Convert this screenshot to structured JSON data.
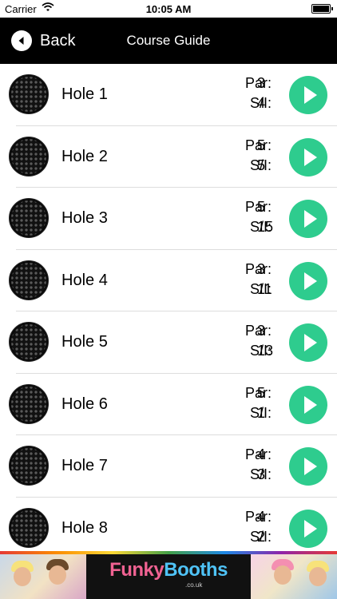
{
  "status_bar": {
    "carrier": "Carrier",
    "time": "10:05 AM"
  },
  "nav": {
    "back_label": "Back",
    "title": "Course Guide"
  },
  "labels": {
    "par": "Par:",
    "si": "S/I:"
  },
  "holes": [
    {
      "name": "Hole 1",
      "par": "3",
      "si": "4"
    },
    {
      "name": "Hole 2",
      "par": "5",
      "si": "5"
    },
    {
      "name": "Hole 3",
      "par": "5",
      "si": "15"
    },
    {
      "name": "Hole 4",
      "par": "3",
      "si": "11"
    },
    {
      "name": "Hole 5",
      "par": "3",
      "si": "13"
    },
    {
      "name": "Hole 6",
      "par": "5",
      "si": "1"
    },
    {
      "name": "Hole 7",
      "par": "4",
      "si": "3"
    },
    {
      "name": "Hole 8",
      "par": "4",
      "si": "2"
    }
  ],
  "ad": {
    "brand_part1": "Funky",
    "brand_part2": "Booths",
    "domain": ".co.uk"
  },
  "colors": {
    "accent": "#2ecc8e",
    "nav_bg": "#000000"
  },
  "icons": {
    "ball": "golf-ball-icon",
    "play": "play-icon",
    "back": "back-arrow-icon",
    "wifi": "wifi-icon",
    "battery": "battery-icon"
  }
}
